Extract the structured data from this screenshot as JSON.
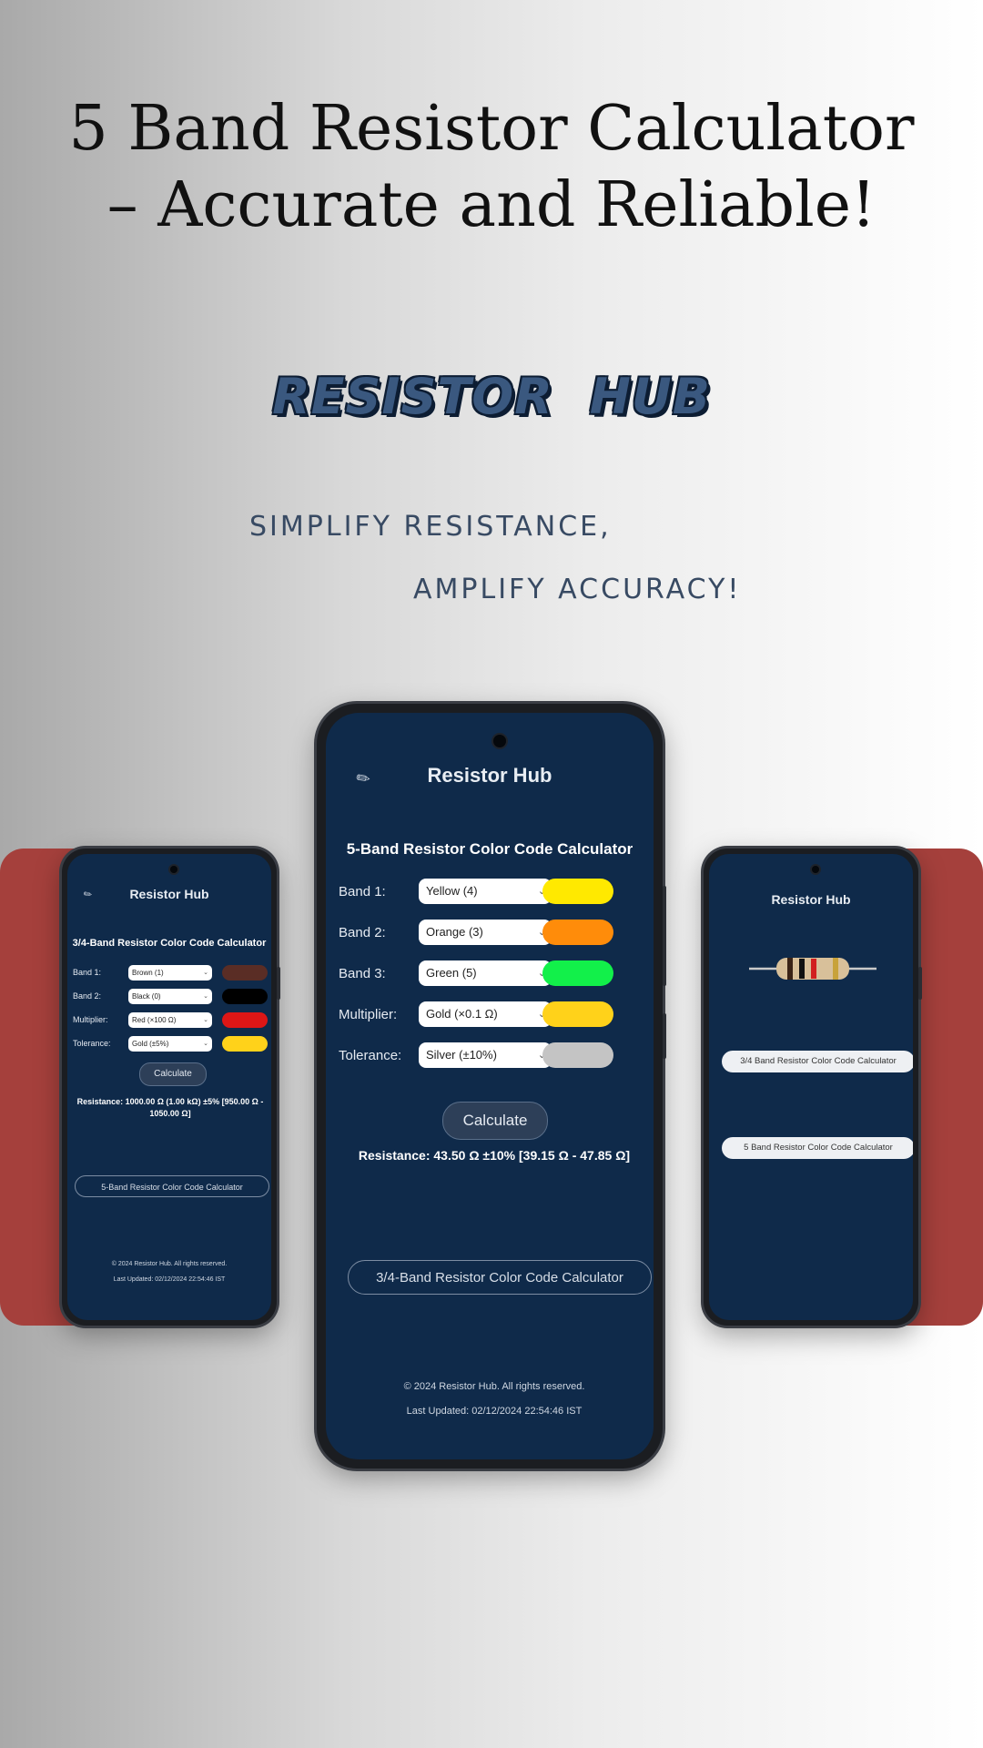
{
  "headline": {
    "line1": "5 Band Resistor Calculator",
    "line2": "– Accurate and Reliable!"
  },
  "brand": {
    "word1": "RESISTOR",
    "word2": "HUB"
  },
  "tagline": {
    "line1": "SIMPLIFY RESISTANCE,",
    "line2": "AMPLIFY ACCURACY!"
  },
  "colors": {
    "accent_line": "#a5403c",
    "screen_bg": "#0f2a4a"
  },
  "main_phone": {
    "app_icon": "resistor-icon",
    "app_title": "Resistor Hub",
    "calc_title": "5-Band Resistor Color Code Calculator",
    "rows": [
      {
        "label": "Band 1:",
        "value": "Yellow (4)",
        "color": "#ffe900"
      },
      {
        "label": "Band 2:",
        "value": "Orange (3)",
        "color": "#ff8c0a"
      },
      {
        "label": "Band 3:",
        "value": "Green (5)",
        "color": "#12f04a"
      },
      {
        "label": "Multiplier:",
        "value": "Gold (×0.1 Ω)",
        "color": "#ffd21a"
      },
      {
        "label": "Tolerance:",
        "value": "Silver (±10%)",
        "color": "#c4c4c4"
      }
    ],
    "calculate_label": "Calculate",
    "result": "Resistance: 43.50 Ω ±10% [39.15 Ω - 47.85 Ω]",
    "alt_button": "3/4-Band Resistor Color Code Calculator",
    "footer_copyright": "© 2024 Resistor Hub. All rights reserved.",
    "footer_updated": "Last Updated: 02/12/2024 22:54:46 IST"
  },
  "left_phone": {
    "app_icon": "resistor-icon",
    "app_title": "Resistor Hub",
    "calc_title": "3/4-Band Resistor Color Code Calculator",
    "rows": [
      {
        "label": "Band 1:",
        "value": "Brown (1)",
        "color": "#5a2d25"
      },
      {
        "label": "Band 2:",
        "value": "Black (0)",
        "color": "#000000"
      },
      {
        "label": "Multiplier:",
        "value": "Red (×100 Ω)",
        "color": "#dd1616"
      },
      {
        "label": "Tolerance:",
        "value": "Gold (±5%)",
        "color": "#ffd21a"
      }
    ],
    "calculate_label": "Calculate",
    "result": "Resistance: 1000.00 Ω (1.00 kΩ) ±5% [950.00 Ω - 1050.00 Ω]",
    "alt_button": "5-Band Resistor Color Code Calculator",
    "footer_copyright": "© 2024 Resistor Hub. All rights reserved.",
    "footer_updated": "Last Updated: 02/12/2024 22:54:46 IST"
  },
  "right_phone": {
    "app_title": "Resistor Hub",
    "image": "resistor-image",
    "option1": "3/4 Band Resistor Color Code Calculator",
    "option2": "5 Band Resistor Color Code Calculator"
  }
}
